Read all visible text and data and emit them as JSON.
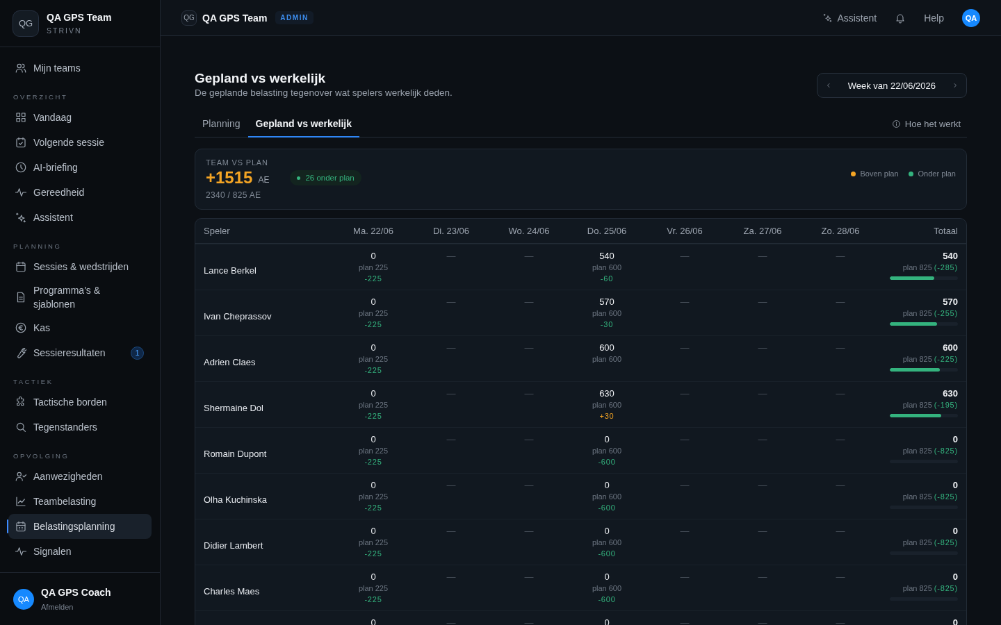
{
  "sidebar": {
    "logo": "QG",
    "team": "QA GPS Team",
    "org": "STRIVN",
    "top_items": [
      {
        "label": "Mijn teams",
        "selected": false
      }
    ],
    "sections": [
      {
        "title": "OVERZICHT",
        "items": [
          {
            "label": "Vandaag",
            "selected": false
          },
          {
            "label": "Volgende sessie",
            "selected": false
          },
          {
            "label": "AI-briefing",
            "selected": false
          },
          {
            "label": "Gereedheid",
            "selected": false
          },
          {
            "label": "Assistent",
            "selected": false
          }
        ]
      },
      {
        "title": "PLANNING",
        "items": [
          {
            "label": "Sessies & wedstrijden",
            "selected": false
          },
          {
            "label": "Programma's & sjablonen",
            "selected": false
          },
          {
            "label": "Kas",
            "selected": false
          },
          {
            "label": "Sessieresultaten",
            "selected": false,
            "badge": "1"
          }
        ]
      },
      {
        "title": "TACTIEK",
        "items": [
          {
            "label": "Tactische borden",
            "selected": false
          },
          {
            "label": "Tegenstanders",
            "selected": false
          }
        ]
      },
      {
        "title": "OPVOLGING",
        "items": [
          {
            "label": "Aanwezigheden",
            "selected": false
          },
          {
            "label": "Teambelasting",
            "selected": false
          },
          {
            "label": "Belastingsplanning",
            "selected": true
          },
          {
            "label": "Signalen",
            "selected": false
          }
        ]
      }
    ],
    "user": {
      "avatar": "QA",
      "name": "QA GPS Coach",
      "action": "Afmelden"
    }
  },
  "topbar": {
    "logo": "QG",
    "team": "QA GPS Team",
    "role": "ADMIN",
    "assistant": "Assistent",
    "help": "Help",
    "avatar": "QA"
  },
  "page": {
    "title": "Gepland vs werkelijk",
    "subtitle": "De geplande belasting tegenover wat spelers werkelijk deden.",
    "week": "Week van 22/06/2026",
    "tabs": [
      {
        "label": "Planning",
        "selected": false
      },
      {
        "label": "Gepland vs werkelijk",
        "selected": true
      }
    ],
    "help_link": "Hoe het werkt"
  },
  "summary": {
    "label": "TEAM VS PLAN",
    "value": "+1515",
    "above_plan": true,
    "unit": "AE",
    "pill": {
      "text": "26 onder plan",
      "above_plan": false
    },
    "detail": "2340 / 825 AE",
    "legend": [
      {
        "label": "Boven plan",
        "color": "#f5a524"
      },
      {
        "label": "Onder plan",
        "color": "#34b37e"
      }
    ]
  },
  "table": {
    "columns": [
      "Speler",
      "Ma. 22/06",
      "Di. 23/06",
      "Wo. 24/06",
      "Do. 25/06",
      "Vr. 26/06",
      "Za. 27/06",
      "Zo. 28/06",
      "Totaal"
    ],
    "rows": [
      {
        "name": "Lance Berkel",
        "days": [
          {
            "kind": "value",
            "actual": "0",
            "plan": "plan 225",
            "diff": "-225",
            "above_plan": false
          },
          {
            "kind": "empty",
            "text": "—"
          },
          {
            "kind": "empty",
            "text": "—"
          },
          {
            "kind": "value",
            "actual": "540",
            "plan": "plan 600",
            "diff": "-60",
            "above_plan": false
          },
          {
            "kind": "empty",
            "text": "—"
          },
          {
            "kind": "empty",
            "text": "—"
          },
          {
            "kind": "empty",
            "text": "—"
          }
        ],
        "total": {
          "actual": "540",
          "plan": "plan 825",
          "diff": "(-285)",
          "above_plan": false,
          "level": 0.65
        }
      },
      {
        "name": "Ivan Cheprassov",
        "days": [
          {
            "kind": "value",
            "actual": "0",
            "plan": "plan 225",
            "diff": "-225",
            "above_plan": false
          },
          {
            "kind": "empty",
            "text": "—"
          },
          {
            "kind": "empty",
            "text": "—"
          },
          {
            "kind": "value",
            "actual": "570",
            "plan": "plan 600",
            "diff": "-30",
            "above_plan": false
          },
          {
            "kind": "empty",
            "text": "—"
          },
          {
            "kind": "empty",
            "text": "—"
          },
          {
            "kind": "empty",
            "text": "—"
          }
        ],
        "total": {
          "actual": "570",
          "plan": "plan 825",
          "diff": "(-255)",
          "above_plan": false,
          "level": 0.69
        }
      },
      {
        "name": "Adrien Claes",
        "days": [
          {
            "kind": "value",
            "actual": "0",
            "plan": "plan 225",
            "diff": "-225",
            "above_plan": false
          },
          {
            "kind": "empty",
            "text": "—"
          },
          {
            "kind": "empty",
            "text": "—"
          },
          {
            "kind": "value",
            "actual": "600",
            "plan": "plan 600"
          },
          {
            "kind": "empty",
            "text": "—"
          },
          {
            "kind": "empty",
            "text": "—"
          },
          {
            "kind": "empty",
            "text": "—"
          }
        ],
        "total": {
          "actual": "600",
          "plan": "plan 825",
          "diff": "(-225)",
          "above_plan": false,
          "level": 0.73
        }
      },
      {
        "name": "Shermaine Dol",
        "days": [
          {
            "kind": "value",
            "actual": "0",
            "plan": "plan 225",
            "diff": "-225",
            "above_plan": false
          },
          {
            "kind": "empty",
            "text": "—"
          },
          {
            "kind": "empty",
            "text": "—"
          },
          {
            "kind": "value",
            "actual": "630",
            "plan": "plan 600",
            "diff": "+30",
            "above_plan": true
          },
          {
            "kind": "empty",
            "text": "—"
          },
          {
            "kind": "empty",
            "text": "—"
          },
          {
            "kind": "empty",
            "text": "—"
          }
        ],
        "total": {
          "actual": "630",
          "plan": "plan 825",
          "diff": "(-195)",
          "above_plan": false,
          "level": 0.76
        }
      },
      {
        "name": "Romain Dupont",
        "days": [
          {
            "kind": "value",
            "actual": "0",
            "plan": "plan 225",
            "diff": "-225",
            "above_plan": false
          },
          {
            "kind": "empty",
            "text": "—"
          },
          {
            "kind": "empty",
            "text": "—"
          },
          {
            "kind": "value",
            "actual": "0",
            "plan": "plan 600",
            "diff": "-600",
            "above_plan": false
          },
          {
            "kind": "empty",
            "text": "—"
          },
          {
            "kind": "empty",
            "text": "—"
          },
          {
            "kind": "empty",
            "text": "—"
          }
        ],
        "total": {
          "actual": "0",
          "plan": "plan 825",
          "diff": "(-825)",
          "above_plan": false,
          "level": 0
        }
      },
      {
        "name": "Olha Kuchinska",
        "days": [
          {
            "kind": "value",
            "actual": "0",
            "plan": "plan 225",
            "diff": "-225",
            "above_plan": false
          },
          {
            "kind": "empty",
            "text": "—"
          },
          {
            "kind": "empty",
            "text": "—"
          },
          {
            "kind": "value",
            "actual": "0",
            "plan": "plan 600",
            "diff": "-600",
            "above_plan": false
          },
          {
            "kind": "empty",
            "text": "—"
          },
          {
            "kind": "empty",
            "text": "—"
          },
          {
            "kind": "empty",
            "text": "—"
          }
        ],
        "total": {
          "actual": "0",
          "plan": "plan 825",
          "diff": "(-825)",
          "above_plan": false,
          "level": 0
        }
      },
      {
        "name": "Didier Lambert",
        "days": [
          {
            "kind": "value",
            "actual": "0",
            "plan": "plan 225",
            "diff": "-225",
            "above_plan": false
          },
          {
            "kind": "empty",
            "text": "—"
          },
          {
            "kind": "empty",
            "text": "—"
          },
          {
            "kind": "value",
            "actual": "0",
            "plan": "plan 600",
            "diff": "-600",
            "above_plan": false
          },
          {
            "kind": "empty",
            "text": "—"
          },
          {
            "kind": "empty",
            "text": "—"
          },
          {
            "kind": "empty",
            "text": "—"
          }
        ],
        "total": {
          "actual": "0",
          "plan": "plan 825",
          "diff": "(-825)",
          "above_plan": false,
          "level": 0
        }
      },
      {
        "name": "Charles Maes",
        "days": [
          {
            "kind": "value",
            "actual": "0",
            "plan": "plan 225",
            "diff": "-225",
            "above_plan": false
          },
          {
            "kind": "empty",
            "text": "—"
          },
          {
            "kind": "empty",
            "text": "—"
          },
          {
            "kind": "value",
            "actual": "0",
            "plan": "plan 600",
            "diff": "-600",
            "above_plan": false
          },
          {
            "kind": "empty",
            "text": "—"
          },
          {
            "kind": "empty",
            "text": "—"
          },
          {
            "kind": "empty",
            "text": "—"
          }
        ],
        "total": {
          "actual": "0",
          "plan": "plan 825",
          "diff": "(-825)",
          "above_plan": false,
          "level": 0
        }
      },
      {
        "days": [
          {
            "kind": "value",
            "actual": "0"
          },
          {
            "kind": "empty",
            "text": "—"
          },
          {
            "kind": "empty",
            "text": "—"
          },
          {
            "kind": "value",
            "actual": "0"
          },
          {
            "kind": "empty",
            "text": "—"
          },
          {
            "kind": "empty",
            "text": "—"
          },
          {
            "kind": "empty",
            "text": "—"
          }
        ],
        "total": {
          "actual": "0"
        }
      }
    ]
  }
}
